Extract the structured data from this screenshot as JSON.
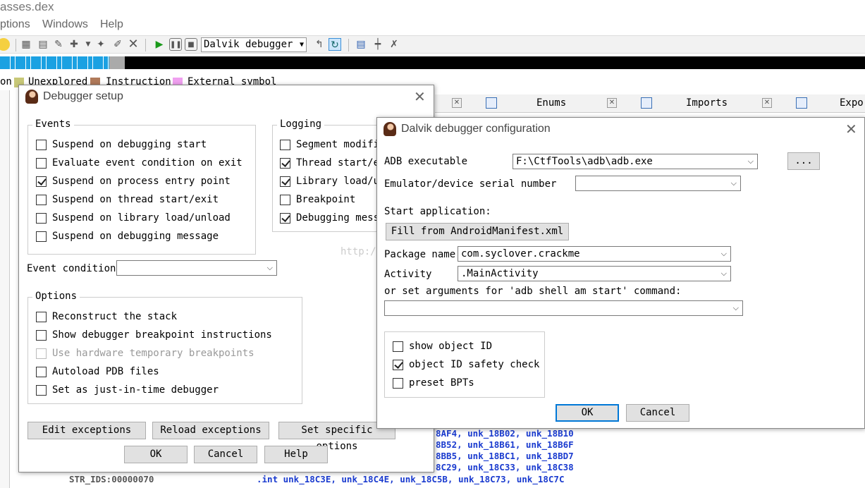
{
  "window": {
    "title": "asses.dex",
    "menu": [
      "ptions",
      "Windows",
      "Help"
    ]
  },
  "toolbar": {
    "debugger_select": "Dalvik debugger"
  },
  "legend": {
    "partial": "on",
    "items": [
      {
        "label": "Unexplored",
        "color": "#c8c878"
      },
      {
        "label": "Instruction",
        "color": "#b07a5a"
      },
      {
        "label": "External symbol",
        "color": "#f0a0f0"
      }
    ]
  },
  "tabs": [
    {
      "label": "Enums"
    },
    {
      "label": "Imports"
    },
    {
      "label": "Expor"
    }
  ],
  "code_lines": [
    {
      "left": "",
      "right": "8AF4, unk_18B02, unk_18B10"
    },
    {
      "left": "",
      "right": "8B52, unk_18B61, unk_18B6F"
    },
    {
      "left": "",
      "right": "8BB5, unk_18BC1, unk_18BD7"
    },
    {
      "left": "",
      "right": "8C29, unk_18C33, unk_18C38"
    },
    {
      "left": "STR_IDS:00000070",
      "right": ".int unk_18C3E, unk_18C4E, unk_18C5B, unk_18C73, unk_18C7C"
    }
  ],
  "debugger_setup": {
    "title": "Debugger setup",
    "events": {
      "label": "Events",
      "items": [
        {
          "label": "Suspend on debugging start",
          "checked": false
        },
        {
          "label": "Evaluate event condition on exit",
          "checked": false
        },
        {
          "label": "Suspend on process entry point",
          "checked": true
        },
        {
          "label": "Suspend on thread start/exit",
          "checked": false
        },
        {
          "label": "Suspend on library load/unload",
          "checked": false
        },
        {
          "label": "Suspend on debugging message",
          "checked": false
        }
      ]
    },
    "logging": {
      "label": "Logging",
      "items": [
        {
          "label": "Segment modific",
          "checked": false
        },
        {
          "label": "Thread start/ex",
          "checked": true
        },
        {
          "label": "Library load/un",
          "checked": true
        },
        {
          "label": "Breakpoint",
          "checked": false
        },
        {
          "label": "Debugging messa",
          "checked": true
        }
      ]
    },
    "event_condition_label": "Event condition",
    "event_condition_value": "",
    "options": {
      "label": "Options",
      "items": [
        {
          "label": "Reconstruct the stack",
          "checked": false,
          "disabled": false
        },
        {
          "label": "Show debugger breakpoint instructions",
          "checked": false,
          "disabled": false
        },
        {
          "label": "Use hardware temporary breakpoints",
          "checked": false,
          "disabled": true
        },
        {
          "label": "Autoload PDB files",
          "checked": false,
          "disabled": false
        },
        {
          "label": "Set as just-in-time debugger",
          "checked": false,
          "disabled": false
        }
      ]
    },
    "buttons": {
      "edit_exceptions": "Edit exceptions",
      "reload_exceptions": "Reload exceptions",
      "set_specific_options": "Set specific options",
      "ok": "OK",
      "cancel": "Cancel",
      "help": "Help"
    }
  },
  "dalvik_config": {
    "title": "Dalvik debugger configuration",
    "adb_label": "ADB executable",
    "adb_value": "F:\\CtfTools\\adb\\adb.exe",
    "browse": "...",
    "serial_label": "Emulator/device serial number",
    "serial_value": "",
    "start_app_label": "Start application:",
    "fill_button": "Fill from AndroidManifest.xml",
    "package_label": "Package name",
    "package_value": "com.syclover.crackme",
    "activity_label": "Activity",
    "activity_value": ".MainActivity",
    "args_label": "or set arguments for 'adb shell am start' command:",
    "args_value": "",
    "checks": [
      {
        "label": "show object ID",
        "checked": false
      },
      {
        "label": "object ID safety check",
        "checked": true
      },
      {
        "label": "preset BPTs",
        "checked": false
      }
    ],
    "ok": "OK",
    "cancel": "Cancel"
  },
  "watermark": "http://"
}
